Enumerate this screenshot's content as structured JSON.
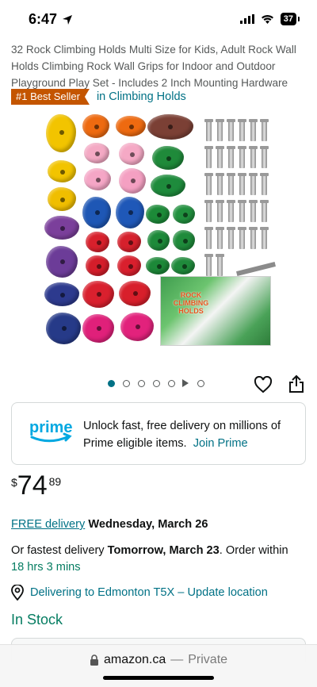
{
  "status_bar": {
    "time": "6:47",
    "battery": "37"
  },
  "product": {
    "title": "32 Rock Climbing Holds Multi Size for Kids, Adult Rock Wall Holds Climbing Rock Wall Grips for Indoor and Outdoor Playground Play Set - Includes 2 Inch Mounting Hardware",
    "badge": "#1 Best Seller",
    "category": "in Climbing Holds",
    "image_box_text": "ROCK CLIMBING HOLDS"
  },
  "prime": {
    "logo_text": "prime",
    "message": "Unlock fast, free delivery on millions of Prime eligible items.",
    "join_label": "Join Prime"
  },
  "price": {
    "symbol": "$",
    "whole": "74",
    "fraction": "89"
  },
  "delivery": {
    "free_label": "FREE delivery",
    "date": "Wednesday, March 26",
    "fastest_prefix": "Or fastest delivery",
    "fastest_date": "Tomorrow, March 23",
    "order_within": ". Order within",
    "countdown": "18 hrs 3 mins"
  },
  "location": {
    "label": "Delivering to Edmonton T5X – Update location"
  },
  "stock": {
    "label": "In Stock"
  },
  "browser": {
    "url": "amazon.ca",
    "separator": "—",
    "mode": "Private"
  },
  "icons": {
    "heart": "heart-icon",
    "share": "share-icon",
    "location": "location-pin-icon",
    "lock": "lock-icon"
  },
  "colors": {
    "link": "#007185",
    "green": "#067d62",
    "badge": "#c45500",
    "prime_blue": "#00a8e1"
  }
}
